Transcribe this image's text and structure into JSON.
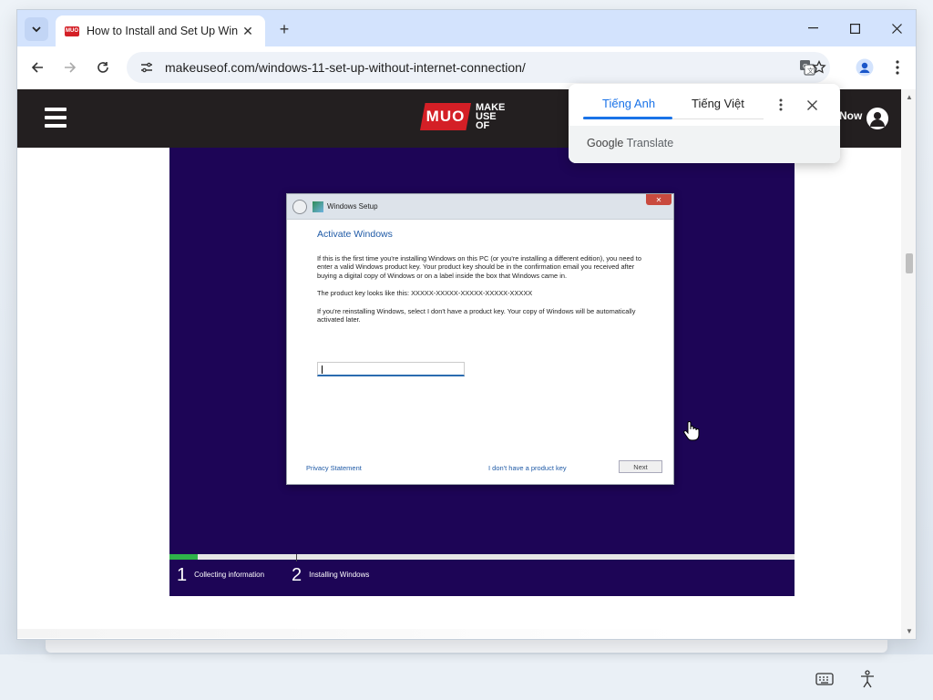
{
  "browser": {
    "tab_title": "How to Install and Set Up Windo",
    "favicon_text": "MUO",
    "url": "makeuseof.com/windows-11-set-up-without-internet-connection/"
  },
  "site_header": {
    "logo_badge": "MUO",
    "logo_line1": "MAKE",
    "logo_line2": "USE",
    "logo_line3": "OF",
    "cta_text": "Now"
  },
  "setup": {
    "window_title": "Windows Setup",
    "heading": "Activate Windows",
    "para1": "If this is the first time you're installing Windows on this PC (or you're installing a different edition), you need to enter a valid Windows product key. Your product key should be in the confirmation email you received after buying a digital copy of Windows or on a label inside the box that Windows came in.",
    "para2": "The product key looks like this: XXXXX-XXXXX-XXXXX-XXXXX-XXXXX",
    "para3": "If you're reinstalling Windows, select I don't have a product key. Your copy of Windows will be automatically activated later.",
    "privacy_link": "Privacy Statement",
    "no_key_link": "I don't have a product key",
    "next_button": "Next",
    "progress_fraction": 0.045,
    "step1_num": "1",
    "step1_label": "Collecting information",
    "step2_num": "2",
    "step2_label": "Installing Windows"
  },
  "translate_popup": {
    "source_lang": "Tiếng Anh",
    "target_lang": "Tiếng Việt",
    "brand_google": "Google",
    "brand_product": "Translate"
  },
  "colors": {
    "tabstrip": "#d3e3fd",
    "site_header": "#231f20",
    "brand_red": "#d41f26",
    "setup_bg": "#1d0556",
    "progress_green": "#2fb34a",
    "link_blue": "#1a73e8"
  }
}
